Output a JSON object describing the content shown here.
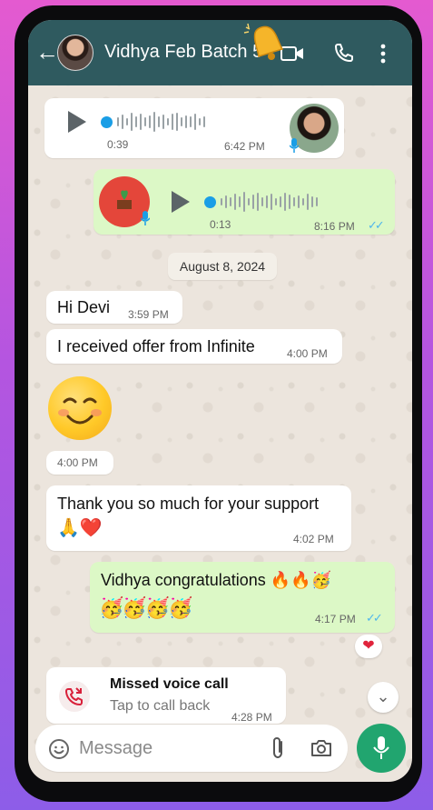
{
  "header": {
    "back_icon": "arrow-left-icon",
    "contact_name": "Vidhya Feb Batch 5",
    "icons": [
      "video-call-icon",
      "phone-icon",
      "more-vertical-icon"
    ]
  },
  "messages": {
    "voice1": {
      "duration": "0:39",
      "time": "6:42 PM"
    },
    "voice2": {
      "duration": "0:13",
      "time": "8:16 PM"
    },
    "date_divider": "August 8, 2024",
    "msg1": {
      "text": "Hi Devi",
      "time": "3:59 PM"
    },
    "msg2": {
      "text": "I received offer from Infinite",
      "time": "4:00 PM"
    },
    "emoji_msg": {
      "time": "4:00 PM"
    },
    "msg3": {
      "text": "Thank you so much for your support",
      "emoji": "🙏❤️",
      "time": "4:02 PM"
    },
    "msg4": {
      "text": "Vidhya congratulations 🔥🔥🥳",
      "emoji_line": "🥳🥳🥳🥳",
      "time": "4:17 PM"
    },
    "reaction": "❤",
    "missed_call": {
      "title": "Missed voice call",
      "subtitle": "Tap to call back",
      "time": "4:28 PM"
    }
  },
  "composer": {
    "placeholder": "Message"
  },
  "colors": {
    "header": "#2f5a5f",
    "outgoing_bubble": "#dcf8c6",
    "mic_button": "#21a56f",
    "read_ticks": "#4fb6ec"
  }
}
